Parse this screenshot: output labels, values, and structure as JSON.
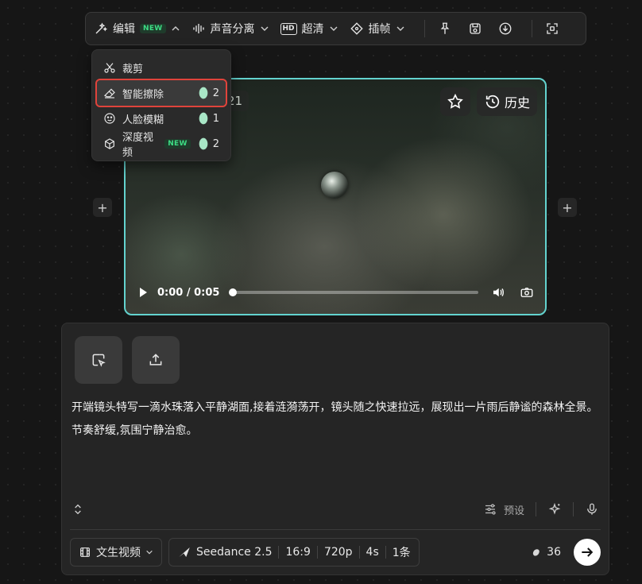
{
  "toolbar": {
    "edit_label": "编辑",
    "edit_badge": "NEW",
    "audio_label": "声音分离",
    "hd_label": "超清",
    "hd_icon_text": "HD",
    "frame_label": "插帧",
    "icons": [
      "pin-icon",
      "save-icon",
      "download-icon",
      "fullscreen-icon"
    ]
  },
  "dropdown": {
    "items": [
      {
        "label": "裁剪",
        "icon": "scissors-icon",
        "cost": ""
      },
      {
        "label": "智能擦除",
        "icon": "eraser-icon",
        "cost": "2",
        "active": true
      },
      {
        "label": "人脸模糊",
        "icon": "face-icon",
        "cost": "1"
      },
      {
        "label": "深度视频",
        "icon": "cube-icon",
        "cost": "2",
        "badge": "NEW"
      }
    ]
  },
  "video": {
    "chip_text": "21",
    "history_label": "历史",
    "time": "0:00 / 0:05",
    "progress": 0
  },
  "panel": {
    "prompt": "开端镜头特写一滴水珠落入平静湖面,接着涟漪荡开，镜头随之快速拉远，展现出一片雨后静谧的森林全景。节奏舒缓,氛围宁静治愈。",
    "preset_label": "预设",
    "mode_label": "文生视频",
    "model": "Seedance 2.5",
    "ratio": "16:9",
    "resolution": "720p",
    "duration": "4s",
    "count": "1条",
    "credits": "36"
  },
  "colors": {
    "accent_border": "#63d3cf",
    "new_badge": "#3ddc84",
    "highlight_outline": "#e0433b"
  }
}
